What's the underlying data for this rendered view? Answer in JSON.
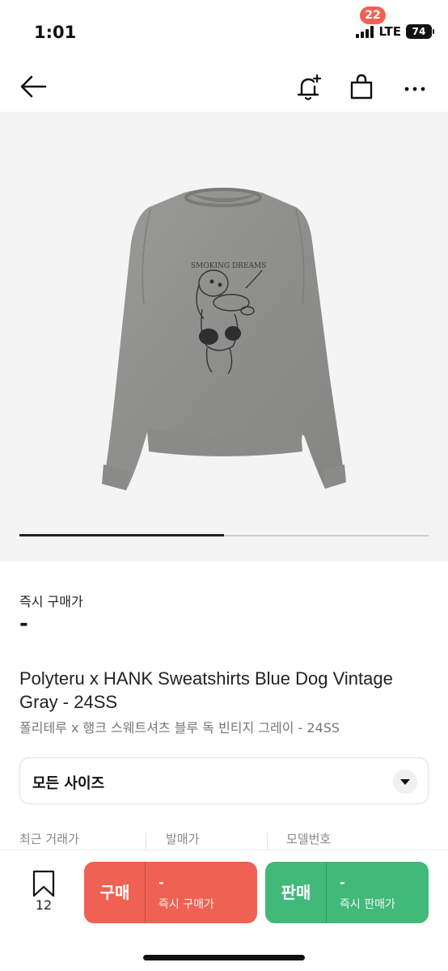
{
  "status_bar": {
    "time": "1:01",
    "network": "LTE",
    "battery": "74"
  },
  "nav": {
    "cart_badge": "22",
    "icons": [
      "back-arrow-icon",
      "alert-plus-icon",
      "shopping-bag-icon",
      "more-icon"
    ]
  },
  "gallery": {
    "progress": 0.5
  },
  "price": {
    "label": "즉시 구매가",
    "value": "-"
  },
  "product": {
    "title_en": "Polyteru x HANK Sweatshirts Blue Dog Vintage Gray - 24SS",
    "title_ko": "폴리테루 x 행크 스웨트셔츠 블루 독 빈티지 그레이 - 24SS",
    "print_text": "SMOKING DREAMS"
  },
  "size_select": {
    "label": "모든 사이즈"
  },
  "info": {
    "columns": [
      "최근 거래가",
      "발매가",
      "모델번호"
    ]
  },
  "bottom_bar": {
    "wish_count": "12",
    "buy": {
      "label": "구매",
      "price": "-",
      "sub": "즉시 구매가"
    },
    "sell": {
      "label": "판매",
      "price": "-",
      "sub": "즉시 판매가"
    }
  },
  "colors": {
    "buy": "#ef6253",
    "sell": "#41b979",
    "badge": "#ef6253"
  }
}
